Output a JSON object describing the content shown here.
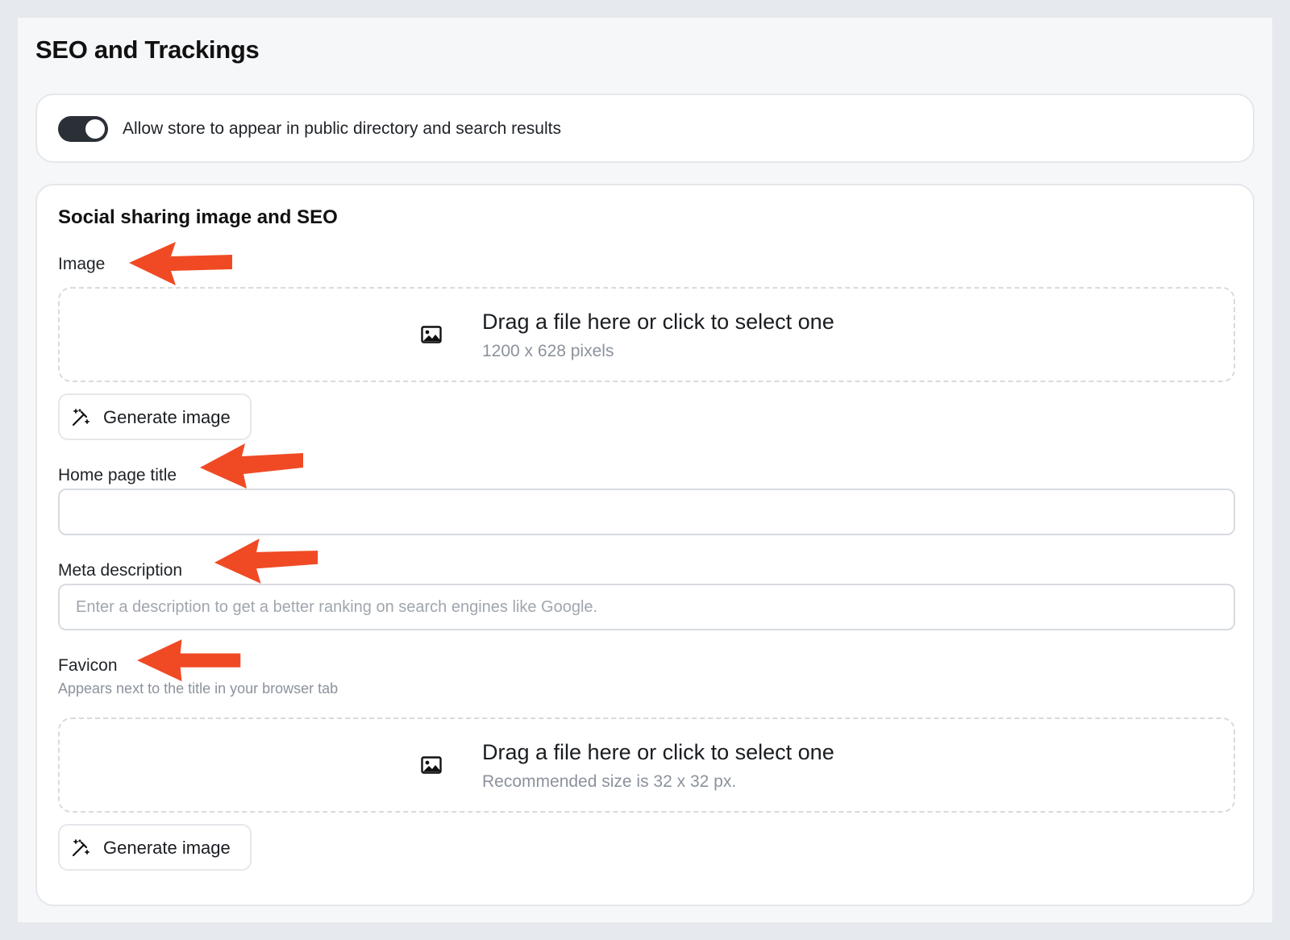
{
  "page": {
    "title": "SEO and Trackings"
  },
  "visibility": {
    "toggle_label": "Allow store to appear in public directory and search results",
    "enabled": true
  },
  "seo": {
    "section_title": "Social sharing image and SEO",
    "image": {
      "label": "Image",
      "dropzone_text": "Drag a file here or click to select one",
      "dropzone_hint": "1200 x 628 pixels",
      "generate_label": "Generate image"
    },
    "home_title": {
      "label": "Home page title",
      "value": "",
      "placeholder": ""
    },
    "meta": {
      "label": "Meta description",
      "value": "",
      "placeholder": "Enter a description to get a better ranking on search engines like Google."
    },
    "favicon": {
      "label": "Favicon",
      "help": "Appears next to the title in your browser tab",
      "dropzone_text": "Drag a file here or click to select one",
      "dropzone_hint": "Recommended size is 32 x 32 px.",
      "generate_label": "Generate image"
    }
  },
  "colors": {
    "annotation_arrow": "#f04a24",
    "toggle_on": "#2b2f36"
  },
  "icons": {
    "dropzone": "image-icon",
    "generate": "magic-wand-icon",
    "annotation": "arrow-left-icon"
  }
}
